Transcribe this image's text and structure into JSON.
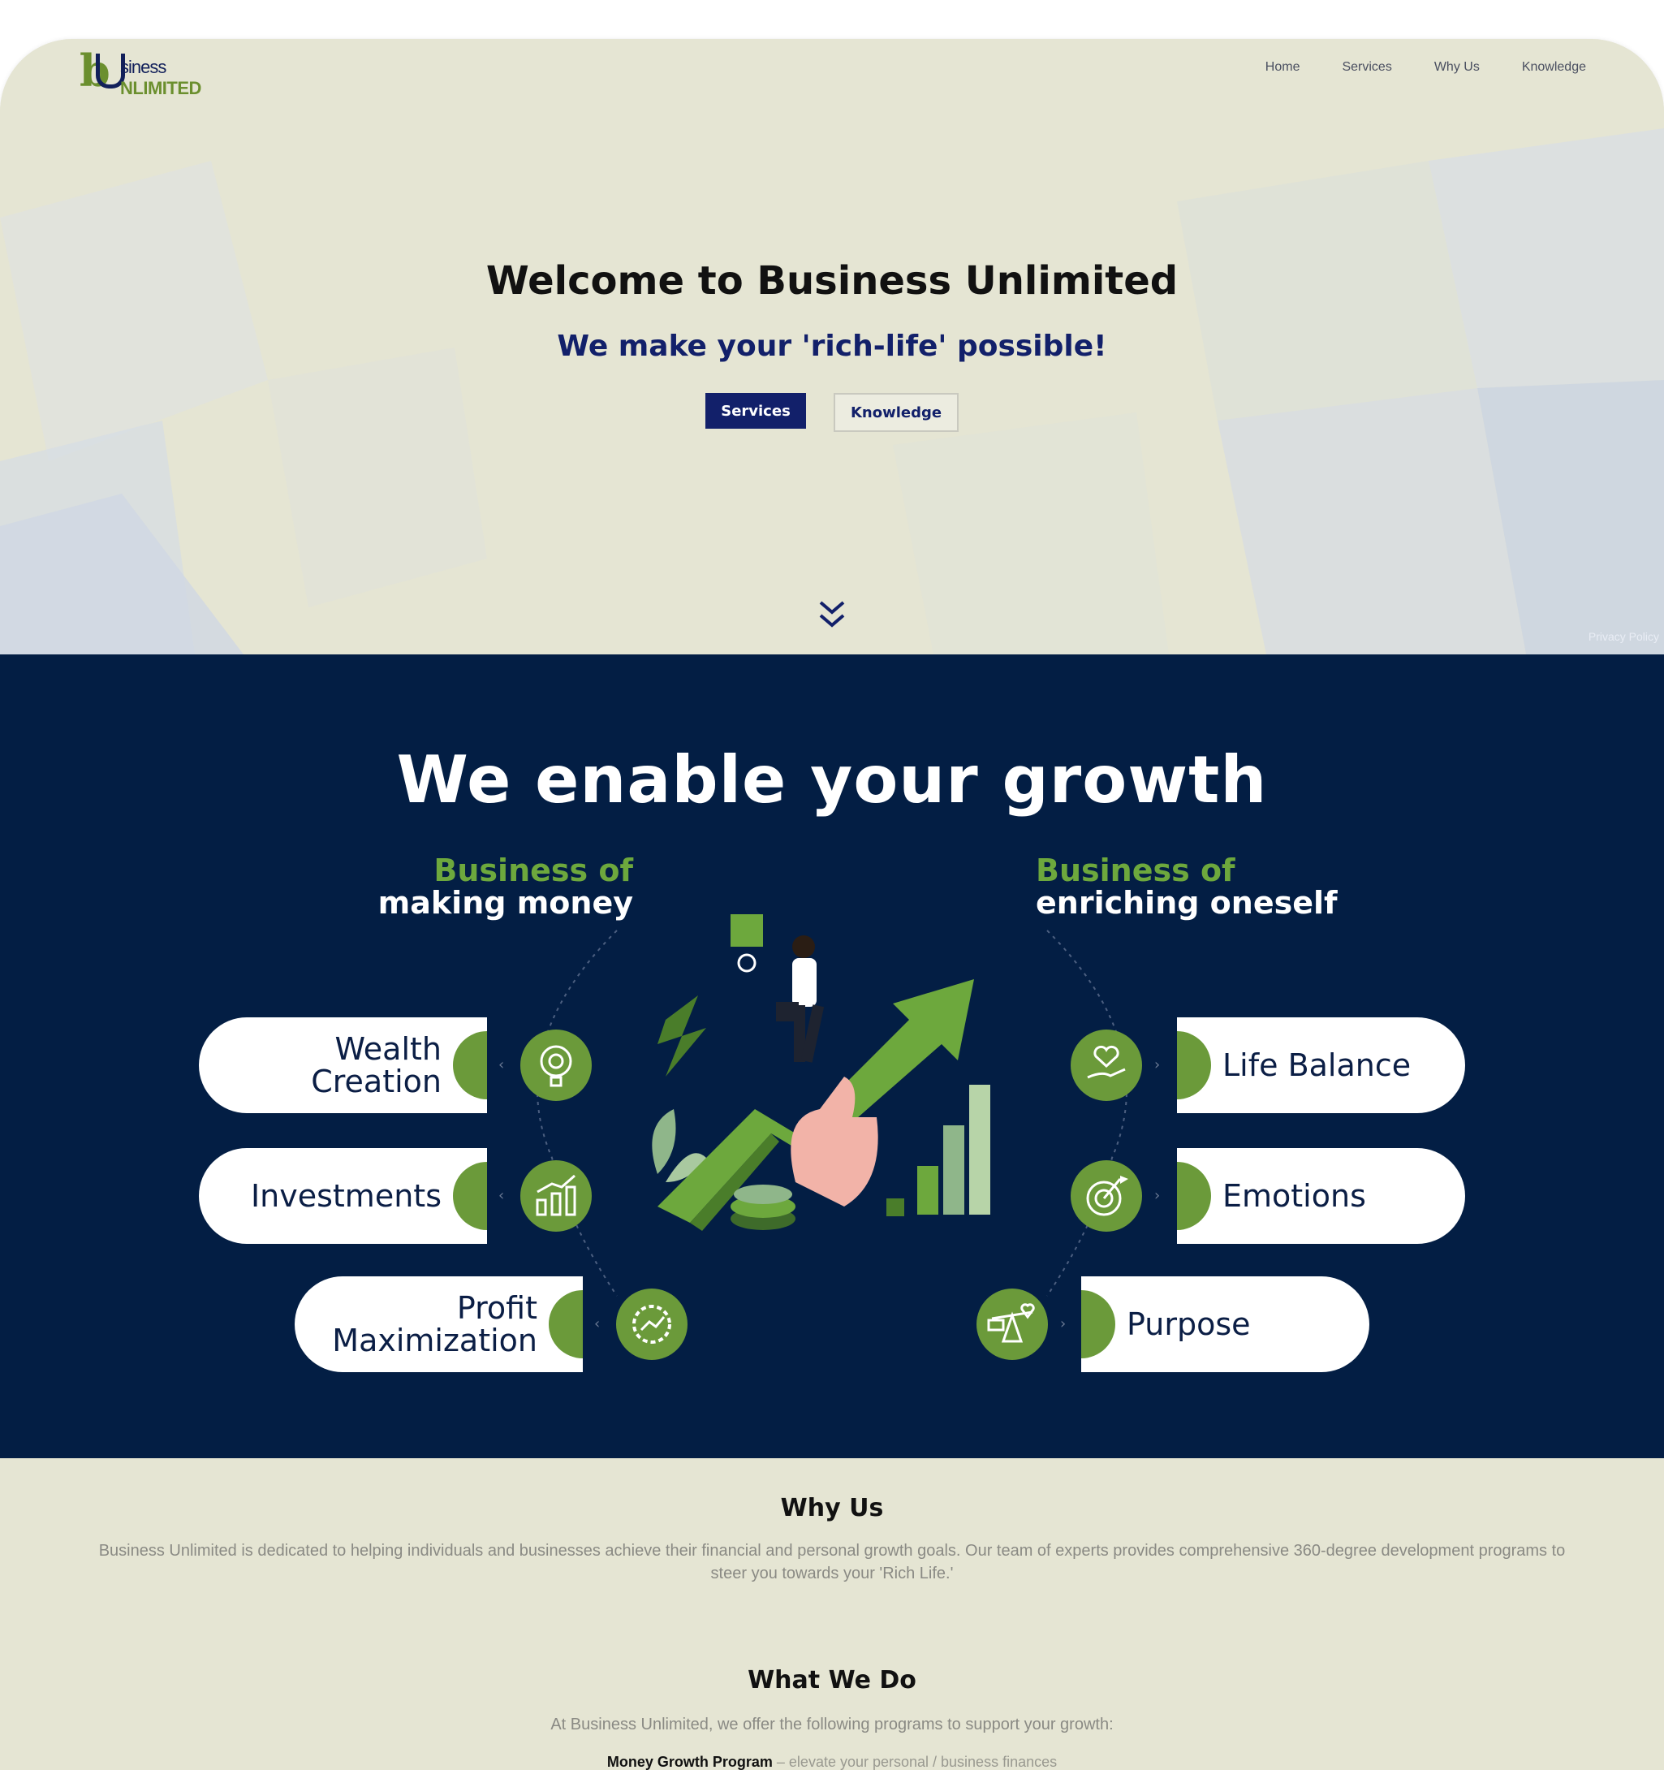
{
  "brand": {
    "logo_letter": "b",
    "logo_top": "siness",
    "logo_bottom": "NLIMITED"
  },
  "nav": {
    "items": [
      {
        "label": "Home"
      },
      {
        "label": "Services"
      },
      {
        "label": "Why Us"
      },
      {
        "label": "Knowledge"
      }
    ]
  },
  "hero": {
    "title": "Welcome to Business Unlimited",
    "subtitle": "We make your 'rich-life' possible!",
    "primary_button": "Services",
    "secondary_button": "Knowledge",
    "scroll_icon": "double-chevron-down-icon",
    "privacy_link": "Privacy Policy"
  },
  "growth": {
    "title": "We enable your growth",
    "left_heading": {
      "accent": "Business of",
      "main": "making money"
    },
    "right_heading": {
      "accent": "Business of",
      "main": "enriching oneself"
    },
    "left_items": [
      {
        "line1": "Wealth",
        "line2": "Creation",
        "icon": "lightbulb-gear-icon"
      },
      {
        "line1": "Investments",
        "line2": "",
        "icon": "bar-chart-up-icon"
      },
      {
        "line1": "Profit",
        "line2": "Maximization",
        "icon": "gear-chart-icon"
      }
    ],
    "right_items": [
      {
        "label": "Life Balance",
        "icon": "heart-hand-icon"
      },
      {
        "label": "Emotions",
        "icon": "target-icon"
      },
      {
        "label": "Purpose",
        "icon": "balance-scale-icon"
      }
    ]
  },
  "why_us": {
    "heading": "Why Us",
    "text": "Business Unlimited is dedicated to helping individuals and businesses achieve their financial and personal growth goals. Our team of experts provides comprehensive 360-degree development programs to steer you towards your 'Rich Life.'"
  },
  "what_we_do": {
    "heading": "What We Do",
    "intro": "At Business Unlimited, we offer the following programs to support your growth:",
    "program_name": "Money Growth Program",
    "program_desc": " – elevate your personal / business finances"
  },
  "colors": {
    "accent_navy": "#12206a",
    "accent_green": "#6b9a3a",
    "dark_section": "#031e44",
    "page_bg": "#e5e5d3"
  }
}
